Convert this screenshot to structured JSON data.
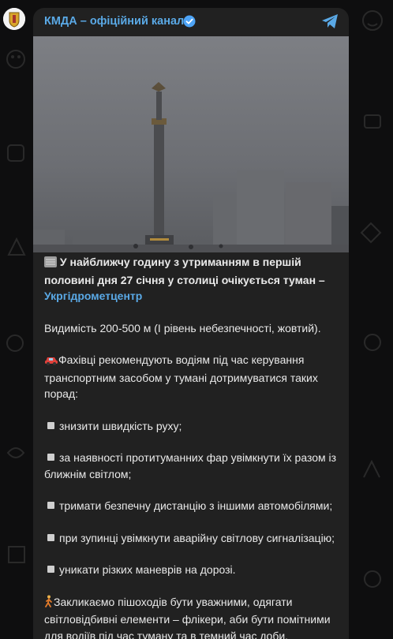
{
  "header": {
    "channel_name": "КМДА – офіційний канал"
  },
  "post": {
    "headline_part1": " У найближчу годину з утриманням в першій половині дня 27 січня у столиці очікується туман –",
    "headline_link": "Укргідрометцентр",
    "visibility": "Видимість 200-500 м (I рівень небезпечності, жовтий).",
    "advice_intro": "Фахівці рекомендують водіям під час керування транспортним засобом у тумані дотримуватися таких порад:",
    "tips": [
      "знизити швидкість руху;",
      "за наявності протитуманних фар увімкнути їх разом із ближнім світлом;",
      "тримати безпечну дистанцію з іншими автомобілями;",
      "при зупинці увімкнути аварійну світлову сигналізацію;",
      "уникати різких маневрів на дорозі."
    ],
    "pedestrians": "Закликаємо пішоходів бути уважними, одягати світловідбивні елементи – флікери, аби бути помітними для водіїв під час туману та в темний час доби."
  }
}
